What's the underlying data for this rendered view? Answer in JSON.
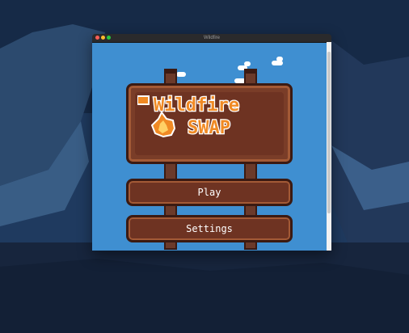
{
  "window": {
    "title": "Wildfire"
  },
  "logo": {
    "line1": "Wildfire",
    "line2": "SWAP"
  },
  "menu": {
    "play_label": "Play",
    "settings_label": "Settings"
  },
  "colors": {
    "sky": "#3f8fd1",
    "wood": "#6e3322",
    "wood_dark": "#3b1a12",
    "wood_highlight": "#a35a36",
    "logo_orange": "#f08a24",
    "logo_outline": "#ffffff"
  },
  "icons": [
    "flame-icon"
  ]
}
